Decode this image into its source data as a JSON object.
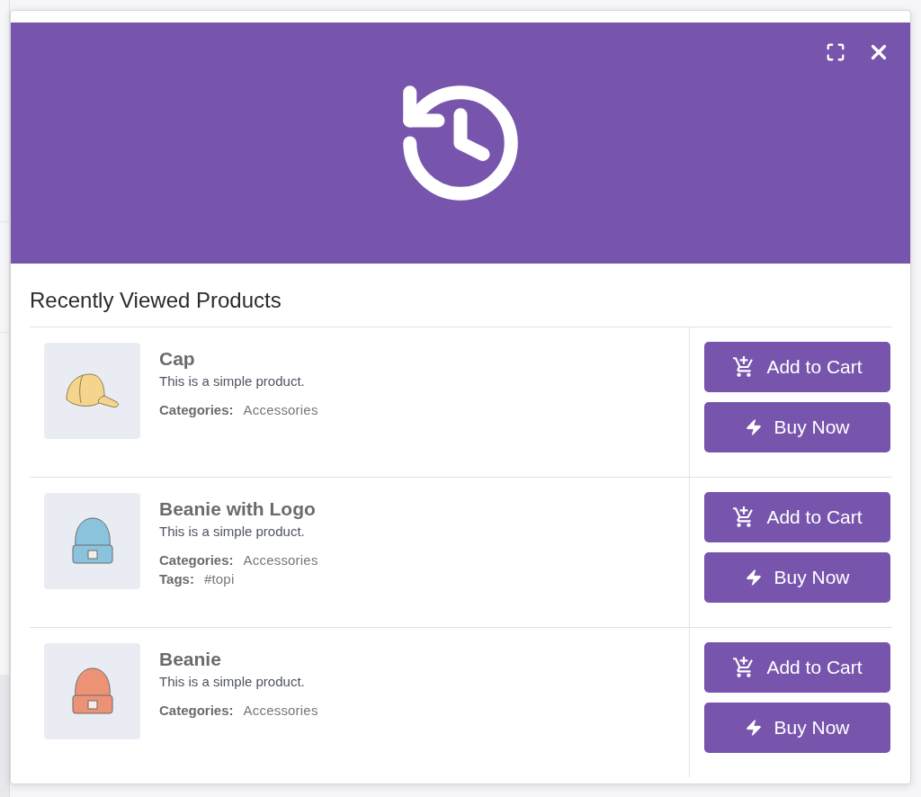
{
  "modal": {
    "title": "Recently Viewed Products",
    "products": [
      {
        "name": "Cap",
        "description": "This is a simple product.",
        "image": {
          "kind": "cap",
          "color": "#f5d58e"
        },
        "meta": [
          {
            "label": "Categories:",
            "value": "Accessories"
          }
        ],
        "actions": [
          {
            "kind": "cart",
            "label": "Add to Cart"
          },
          {
            "kind": "buy",
            "label": "Buy Now"
          }
        ]
      },
      {
        "name": "Beanie with Logo",
        "description": "This is a simple product.",
        "image": {
          "kind": "beanie",
          "color": "#8cc3dc"
        },
        "meta": [
          {
            "label": "Categories:",
            "value": "Accessories"
          },
          {
            "label": "Tags:",
            "value": "#topi"
          }
        ],
        "actions": [
          {
            "kind": "cart",
            "label": "Add to Cart"
          },
          {
            "kind": "buy",
            "label": "Buy Now"
          }
        ]
      },
      {
        "name": "Beanie",
        "description": "This is a simple product.",
        "image": {
          "kind": "beanie",
          "color": "#ee9275"
        },
        "meta": [
          {
            "label": "Categories:",
            "value": "Accessories"
          }
        ],
        "actions": [
          {
            "kind": "cart",
            "label": "Add to Cart"
          },
          {
            "kind": "buy",
            "label": "Buy Now"
          }
        ]
      }
    ]
  }
}
